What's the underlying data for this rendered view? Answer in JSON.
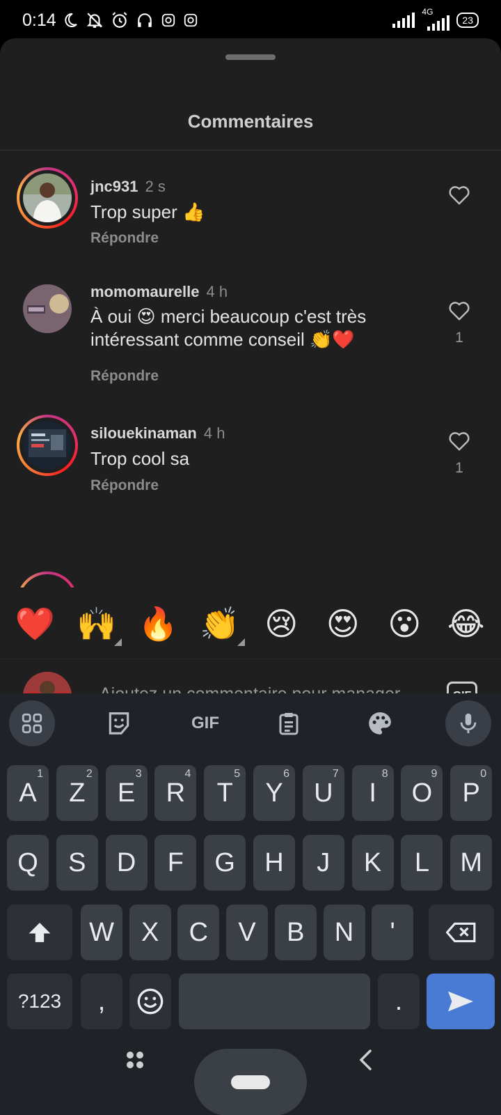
{
  "status": {
    "time": "0:14",
    "network": "4G",
    "battery": "23"
  },
  "sheet": {
    "title": "Commentaires"
  },
  "comments": [
    {
      "user": "jnc931",
      "ago": "2 s",
      "text": "Trop super 👍",
      "reply": "Répondre",
      "likes": ""
    },
    {
      "user": "momomaurelle",
      "ago": "4 h",
      "text": "À oui 😍 merci beaucoup c'est très intéressant comme conseil 👏❤️",
      "reply": "Répondre",
      "likes": "1"
    },
    {
      "user": "silouekinaman",
      "ago": "4 h",
      "text": "Trop cool sa",
      "reply": "Répondre",
      "likes": "1"
    }
  ],
  "emoji_bar": [
    "❤️",
    "🙌",
    "🔥",
    "👏",
    "😢",
    "😍",
    "😮",
    "😂"
  ],
  "input": {
    "placeholder": "Ajoutez un commentaire pour manager",
    "gif_label": "GIF"
  },
  "keyboard": {
    "toolbar_gif": "GIF",
    "row1": [
      {
        "k": "A",
        "h": "1"
      },
      {
        "k": "Z",
        "h": "2"
      },
      {
        "k": "E",
        "h": "3"
      },
      {
        "k": "R",
        "h": "4"
      },
      {
        "k": "T",
        "h": "5"
      },
      {
        "k": "Y",
        "h": "6"
      },
      {
        "k": "U",
        "h": "7"
      },
      {
        "k": "I",
        "h": "8"
      },
      {
        "k": "O",
        "h": "9"
      },
      {
        "k": "P",
        "h": "0"
      }
    ],
    "row2": [
      "Q",
      "S",
      "D",
      "F",
      "G",
      "H",
      "J",
      "K",
      "L",
      "M"
    ],
    "row3": [
      "W",
      "X",
      "C",
      "V",
      "B",
      "N",
      "'"
    ],
    "symbols_key": "?123",
    "comma_key": ",",
    "period_key": "."
  }
}
